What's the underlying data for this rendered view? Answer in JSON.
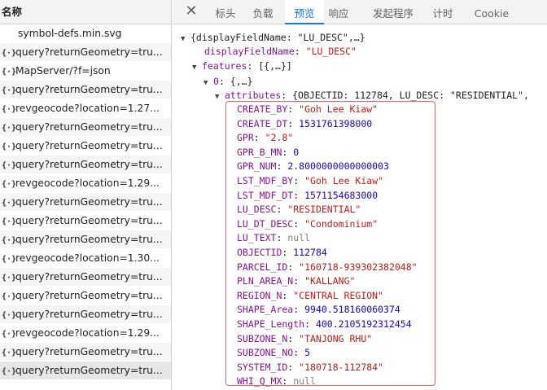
{
  "left_panel": {
    "header": "名称",
    "requests": [
      {
        "icon": "",
        "name": "symbol-defs.min.svg"
      },
      {
        "icon": "{·}",
        "name": "query?returnGeometry=tru..."
      },
      {
        "icon": "{·}",
        "name": "MapServer/?f=json"
      },
      {
        "icon": "{·}",
        "name": "query?returnGeometry=tru..."
      },
      {
        "icon": "{·}",
        "name": "revgeocode?location=1.27..."
      },
      {
        "icon": "{·}",
        "name": "query?returnGeometry=tru..."
      },
      {
        "icon": "{·}",
        "name": "query?returnGeometry=tru..."
      },
      {
        "icon": "{·}",
        "name": "query?returnGeometry=tru..."
      },
      {
        "icon": "{·}",
        "name": "revgeocode?location=1.29..."
      },
      {
        "icon": "{·}",
        "name": "query?returnGeometry=tru..."
      },
      {
        "icon": "{·}",
        "name": "query?returnGeometry=tru..."
      },
      {
        "icon": "{·}",
        "name": "query?returnGeometry=tru..."
      },
      {
        "icon": "{·}",
        "name": "revgeocode?location=1.30..."
      },
      {
        "icon": "{·}",
        "name": "query?returnGeometry=tru..."
      },
      {
        "icon": "{·}",
        "name": "query?returnGeometry=tru..."
      },
      {
        "icon": "{·}",
        "name": "query?returnGeometry=tru..."
      },
      {
        "icon": "{·}",
        "name": "revgeocode?location=1.29..."
      },
      {
        "icon": "{·}",
        "name": "query?returnGeometry=tru..."
      },
      {
        "icon": "{·}",
        "name": "query?returnGeometry=tru..."
      }
    ]
  },
  "tabs": {
    "close_glyph": "✕",
    "items": [
      "标头",
      "负载",
      "预览",
      "响应",
      "发起程序",
      "计时",
      "Cookie"
    ],
    "active": "预览"
  },
  "preview": {
    "root_summary": "{displayFieldName: \"LU_DESC\",…}",
    "display_field_key": "displayFieldName",
    "display_field_value": "\"LU_DESC\"",
    "features_key": "features",
    "features_summary": "[{,…}]",
    "item0_key": "0",
    "item0_summary": "{,…}",
    "attributes_key": "attributes",
    "attributes_summary": "{OBJECTID: 112784, LU_DESC: \"RESIDENTIAL\",",
    "fields": [
      {
        "key": "CREATE_BY",
        "value": "\"Goh Lee Kiaw\"",
        "type": "s"
      },
      {
        "key": "CREATE_DT",
        "value": "1531761398000",
        "type": "n"
      },
      {
        "key": "GPR",
        "value": "\"2.8\"",
        "type": "s"
      },
      {
        "key": "GPR_B_MN",
        "value": "0",
        "type": "n"
      },
      {
        "key": "GPR_NUM",
        "value": "2.8000000000000003",
        "type": "n"
      },
      {
        "key": "LST_MDF_BY",
        "value": "\"Goh Lee Kiaw\"",
        "type": "s"
      },
      {
        "key": "LST_MDF_DT",
        "value": "1571154683000",
        "type": "n"
      },
      {
        "key": "LU_DESC",
        "value": "\"RESIDENTIAL\"",
        "type": "s"
      },
      {
        "key": "LU_DT_DESC",
        "value": "\"Condominium\"",
        "type": "s"
      },
      {
        "key": "LU_TEXT",
        "value": "null",
        "type": "nl"
      },
      {
        "key": "OBJECTID",
        "value": "112784",
        "type": "n"
      },
      {
        "key": "PARCEL_ID",
        "value": "\"160718-939302382048\"",
        "type": "s"
      },
      {
        "key": "PLN_AREA_N",
        "value": "\"KALLANG\"",
        "type": "s"
      },
      {
        "key": "REGION_N",
        "value": "\"CENTRAL REGION\"",
        "type": "s"
      },
      {
        "key": "SHAPE_Area",
        "value": "9940.518160060374",
        "type": "n"
      },
      {
        "key": "SHAPE_Length",
        "value": "400.2105192312454",
        "type": "n"
      },
      {
        "key": "SUBZONE_N",
        "value": "\"TANJONG RHU\"",
        "type": "s"
      },
      {
        "key": "SUBZONE_NO",
        "value": "5",
        "type": "n"
      },
      {
        "key": "SYSTEM_ID",
        "value": "\"180718-112784\"",
        "type": "s"
      },
      {
        "key": "WHI_Q_MX",
        "value": "null",
        "type": "nl"
      }
    ],
    "highlight_color": "#e06666"
  }
}
